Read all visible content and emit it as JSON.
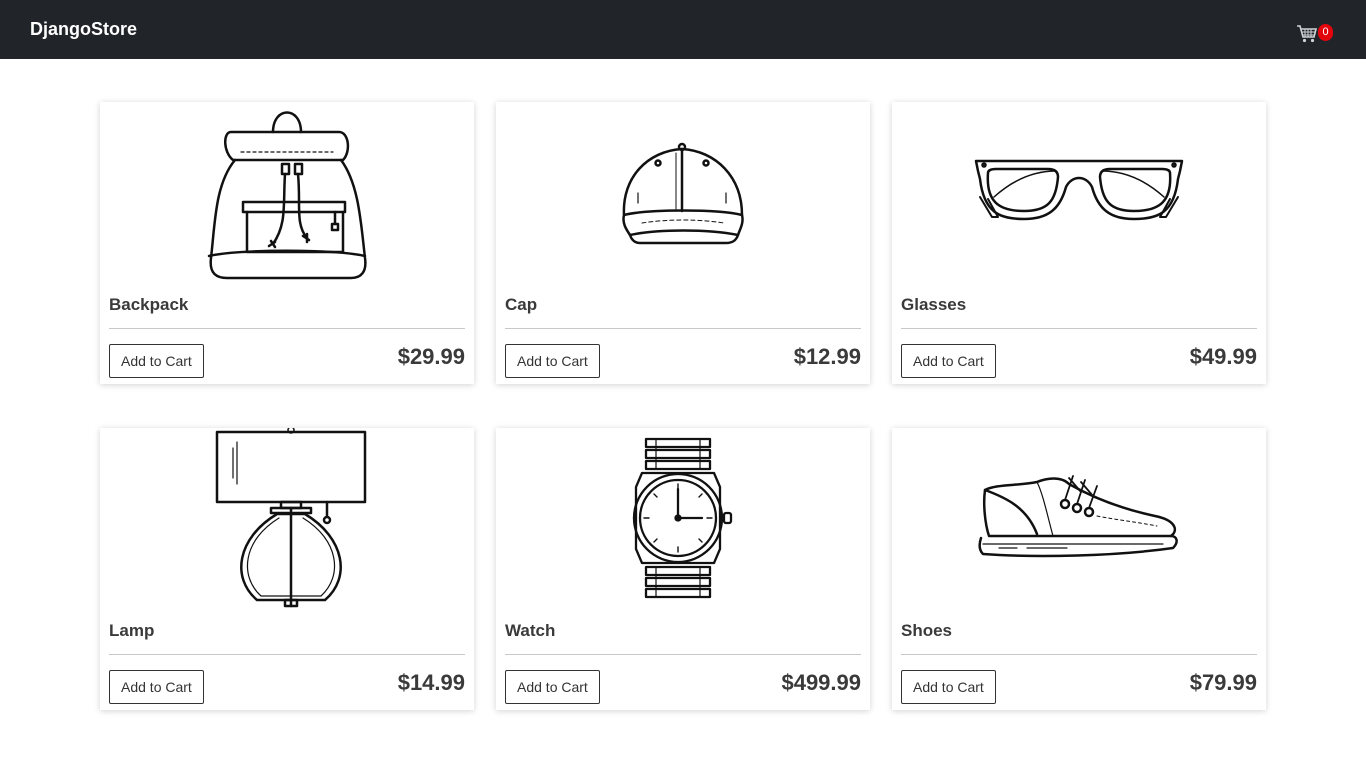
{
  "navbar": {
    "brand": "DjangoStore",
    "cart_count": "0",
    "cart_icon": "shopping-cart-icon",
    "cart_badge_color": "#e3050c",
    "background": "#212529"
  },
  "products": [
    {
      "name": "Backpack",
      "price": "$29.99",
      "button": "Add to Cart",
      "image": "backpack"
    },
    {
      "name": "Cap",
      "price": "$12.99",
      "button": "Add to Cart",
      "image": "cap"
    },
    {
      "name": "Glasses",
      "price": "$49.99",
      "button": "Add to Cart",
      "image": "glasses"
    },
    {
      "name": "Lamp",
      "price": "$14.99",
      "button": "Add to Cart",
      "image": "lamp"
    },
    {
      "name": "Watch",
      "price": "$499.99",
      "button": "Add to Cart",
      "image": "watch"
    },
    {
      "name": "Shoes",
      "price": "$79.99",
      "button": "Add to Cart",
      "image": "shoes"
    }
  ]
}
